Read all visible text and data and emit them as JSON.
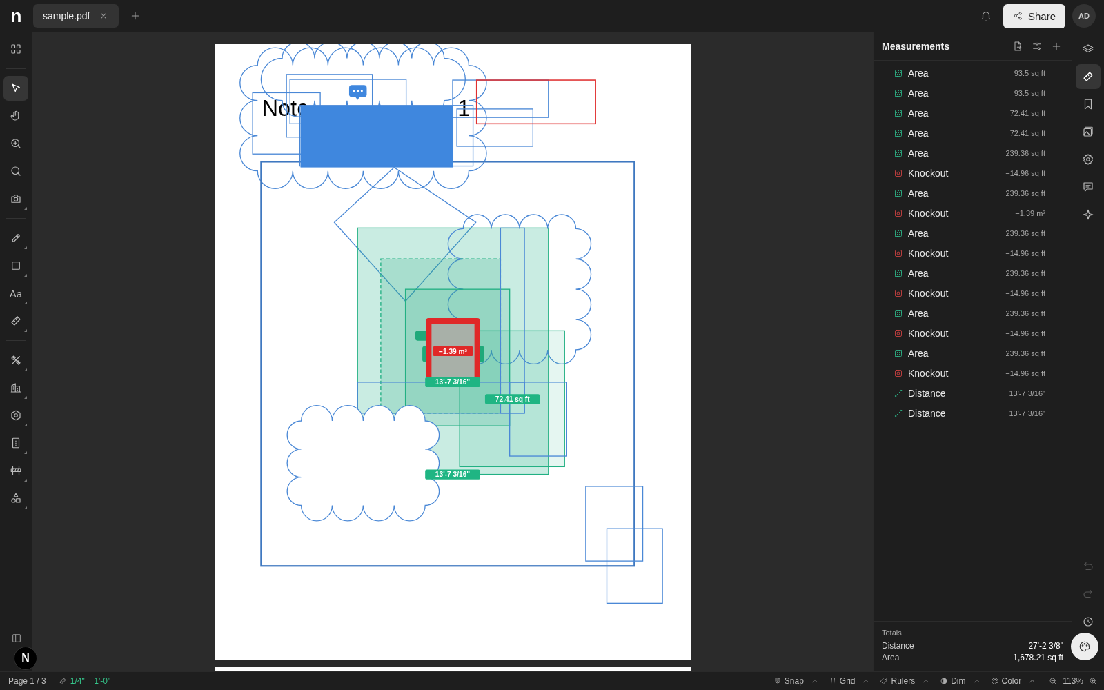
{
  "topbar": {
    "logo": "n",
    "tabs": [
      {
        "label": "sample.pdf",
        "selected": true
      }
    ],
    "share": "Share",
    "avatar": "AD"
  },
  "left_toolbar": {
    "tools": [
      {
        "selected": false,
        "has_menu": false
      },
      {
        "selected": true,
        "has_menu": false
      },
      {
        "selected": false,
        "has_menu": false
      },
      {
        "selected": false,
        "has_menu": false
      },
      {
        "selected": false,
        "has_menu": false
      },
      {
        "selected": false,
        "has_menu": true
      },
      {
        "selected": false,
        "has_menu": true
      },
      {
        "selected": false,
        "has_menu": true
      },
      {
        "selected": false,
        "has_menu": true,
        "label": "Aa"
      },
      {
        "selected": false,
        "has_menu": true
      },
      {
        "selected": false,
        "has_menu": true
      },
      {
        "selected": false,
        "has_menu": true
      },
      {
        "selected": false,
        "has_menu": true
      },
      {
        "selected": false,
        "has_menu": true
      },
      {
        "selected": false,
        "has_menu": true
      },
      {
        "selected": false,
        "has_menu": true
      }
    ],
    "badge": "N"
  },
  "canvas": {
    "heading_parts": [
      "Notc",
      "1"
    ],
    "labels": [
      {
        "kind": "knockout",
        "text": "−1.39 m²"
      },
      {
        "kind": "distance",
        "text": "13'-7 3/16\""
      },
      {
        "kind": "area",
        "text": "72.41 sq ft"
      },
      {
        "kind": "distance",
        "text": "13'-7 3/16\""
      }
    ]
  },
  "measurements": {
    "title": "Measurements",
    "items": [
      {
        "kind": "area",
        "label": "Area",
        "value": "93.5 sq ft"
      },
      {
        "kind": "area",
        "label": "Area",
        "value": "93.5 sq ft"
      },
      {
        "kind": "area",
        "label": "Area",
        "value": "72.41 sq ft"
      },
      {
        "kind": "area",
        "label": "Area",
        "value": "72.41 sq ft"
      },
      {
        "kind": "area",
        "label": "Area",
        "value": "239.36 sq ft"
      },
      {
        "kind": "knockout",
        "label": "Knockout",
        "value": "−14.96 sq ft"
      },
      {
        "kind": "area",
        "label": "Area",
        "value": "239.36 sq ft"
      },
      {
        "kind": "knockout",
        "label": "Knockout",
        "value": "−1.39 m²"
      },
      {
        "kind": "area",
        "label": "Area",
        "value": "239.36 sq ft"
      },
      {
        "kind": "knockout",
        "label": "Knockout",
        "value": "−14.96 sq ft"
      },
      {
        "kind": "area",
        "label": "Area",
        "value": "239.36 sq ft"
      },
      {
        "kind": "knockout",
        "label": "Knockout",
        "value": "−14.96 sq ft"
      },
      {
        "kind": "area",
        "label": "Area",
        "value": "239.36 sq ft"
      },
      {
        "kind": "knockout",
        "label": "Knockout",
        "value": "−14.96 sq ft"
      },
      {
        "kind": "area",
        "label": "Area",
        "value": "239.36 sq ft"
      },
      {
        "kind": "knockout",
        "label": "Knockout",
        "value": "−14.96 sq ft"
      },
      {
        "kind": "distance",
        "label": "Distance",
        "value": "13'-7 3/16\""
      },
      {
        "kind": "distance",
        "label": "Distance",
        "value": "13'-7 3/16\""
      }
    ],
    "totals": {
      "title": "Totals",
      "rows": [
        {
          "label": "Distance",
          "value": "27'-2 3/8\""
        },
        {
          "label": "Area",
          "value": "1,678.21 sq ft"
        }
      ]
    }
  },
  "right_rail": {
    "panels": [
      {
        "selected": false
      },
      {
        "selected": true
      },
      {
        "selected": false
      },
      {
        "selected": false
      },
      {
        "selected": false
      },
      {
        "selected": false
      },
      {
        "selected": false
      }
    ],
    "history": [
      {
        "disabled": true
      },
      {
        "disabled": true
      }
    ]
  },
  "status_bar": {
    "page": "Page 1 / 3",
    "scale": "1/4\" = 1'-0\"",
    "toggles": [
      {
        "label": "Snap"
      },
      {
        "label": "Grid"
      },
      {
        "label": "Rulers"
      },
      {
        "label": "Dim"
      },
      {
        "label": "Color"
      }
    ],
    "zoom": "113%"
  }
}
